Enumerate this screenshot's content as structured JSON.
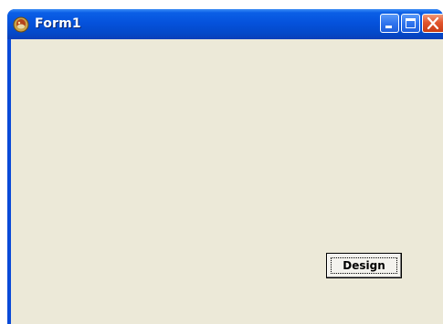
{
  "window": {
    "title": "Form1",
    "icon": "delphi-app-icon"
  },
  "caption_buttons": {
    "minimize": "minimize-icon",
    "maximize": "maximize-icon",
    "close": "close-icon"
  },
  "form": {
    "design_button_label": "Design"
  },
  "colors": {
    "titlebar": "#0552dc",
    "client_background": "#ece9d8",
    "close_button": "#e2562e"
  }
}
